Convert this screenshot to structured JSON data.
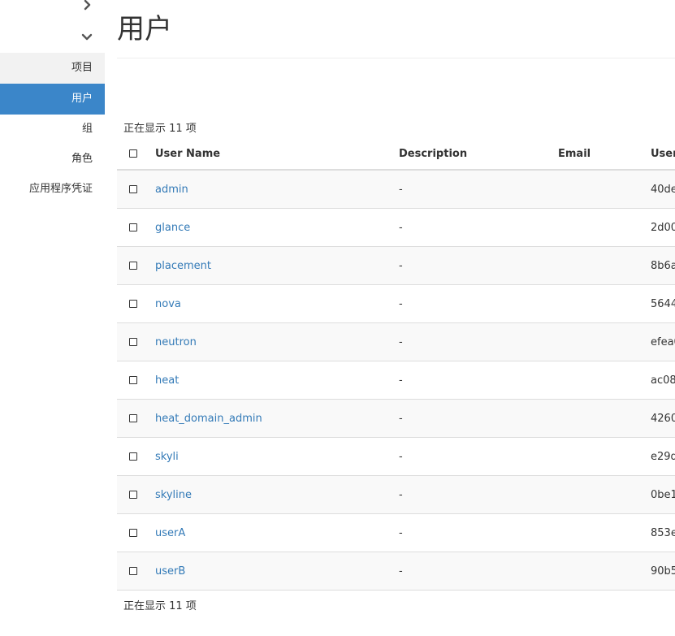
{
  "sidebar": {
    "items": [
      {
        "label": "项目"
      },
      {
        "label": "用户"
      },
      {
        "label": "组"
      },
      {
        "label": "角色"
      },
      {
        "label": "应用程序凭证"
      }
    ],
    "active_index": 1
  },
  "page": {
    "title": "用户"
  },
  "table": {
    "count_text": "正在显示 11 项",
    "headers": {
      "user_name": "User Name",
      "description": "Description",
      "email": "Email",
      "user_id": "User"
    },
    "rows": [
      {
        "name": "admin",
        "description": "-",
        "email": "",
        "id": "40de"
      },
      {
        "name": "glance",
        "description": "-",
        "email": "",
        "id": "2d00"
      },
      {
        "name": "placement",
        "description": "-",
        "email": "",
        "id": "8b6a"
      },
      {
        "name": "nova",
        "description": "-",
        "email": "",
        "id": "5644"
      },
      {
        "name": "neutron",
        "description": "-",
        "email": "",
        "id": "efea0"
      },
      {
        "name": "heat",
        "description": "-",
        "email": "",
        "id": "ac08"
      },
      {
        "name": "heat_domain_admin",
        "description": "-",
        "email": "",
        "id": "4260"
      },
      {
        "name": "skyli",
        "description": "-",
        "email": "",
        "id": "e29d"
      },
      {
        "name": "skyline",
        "description": "-",
        "email": "",
        "id": "0be1"
      },
      {
        "name": "userA",
        "description": "-",
        "email": "",
        "id": "853e"
      },
      {
        "name": "userB",
        "description": "-",
        "email": "",
        "id": "90b5"
      }
    ]
  },
  "colors": {
    "accent": "#3b86c9",
    "link": "#337ab7",
    "row_stripe": "#f9f9f9",
    "border": "#dddddd"
  }
}
